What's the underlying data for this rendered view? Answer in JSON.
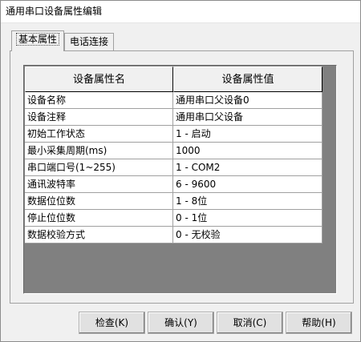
{
  "window": {
    "title": "通用串口设备属性编辑"
  },
  "tabs": [
    {
      "label": "基本属性",
      "active": true
    },
    {
      "label": "电话连接",
      "active": false
    }
  ],
  "grid": {
    "columns": [
      "设备属性名",
      "设备属性值"
    ],
    "rows": [
      {
        "name": "设备名称",
        "value": "通用串口父设备0"
      },
      {
        "name": "设备注释",
        "value": "通用串口父设备"
      },
      {
        "name": "初始工作状态",
        "value": "1 - 启动"
      },
      {
        "name": "最小采集周期(ms)",
        "value": "1000"
      },
      {
        "name": "串口端口号(1~255)",
        "value": "1 - COM2"
      },
      {
        "name": "通讯波特率",
        "value": "6 - 9600"
      },
      {
        "name": "数据位位数",
        "value": "1 - 8位"
      },
      {
        "name": "停止位位数",
        "value": "0 - 1位"
      },
      {
        "name": "数据校验方式",
        "value": "0 - 无校验"
      }
    ]
  },
  "buttons": {
    "check": "检查(K)",
    "ok": "确认(Y)",
    "cancel": "取消(C)",
    "help": "帮助(H)"
  }
}
